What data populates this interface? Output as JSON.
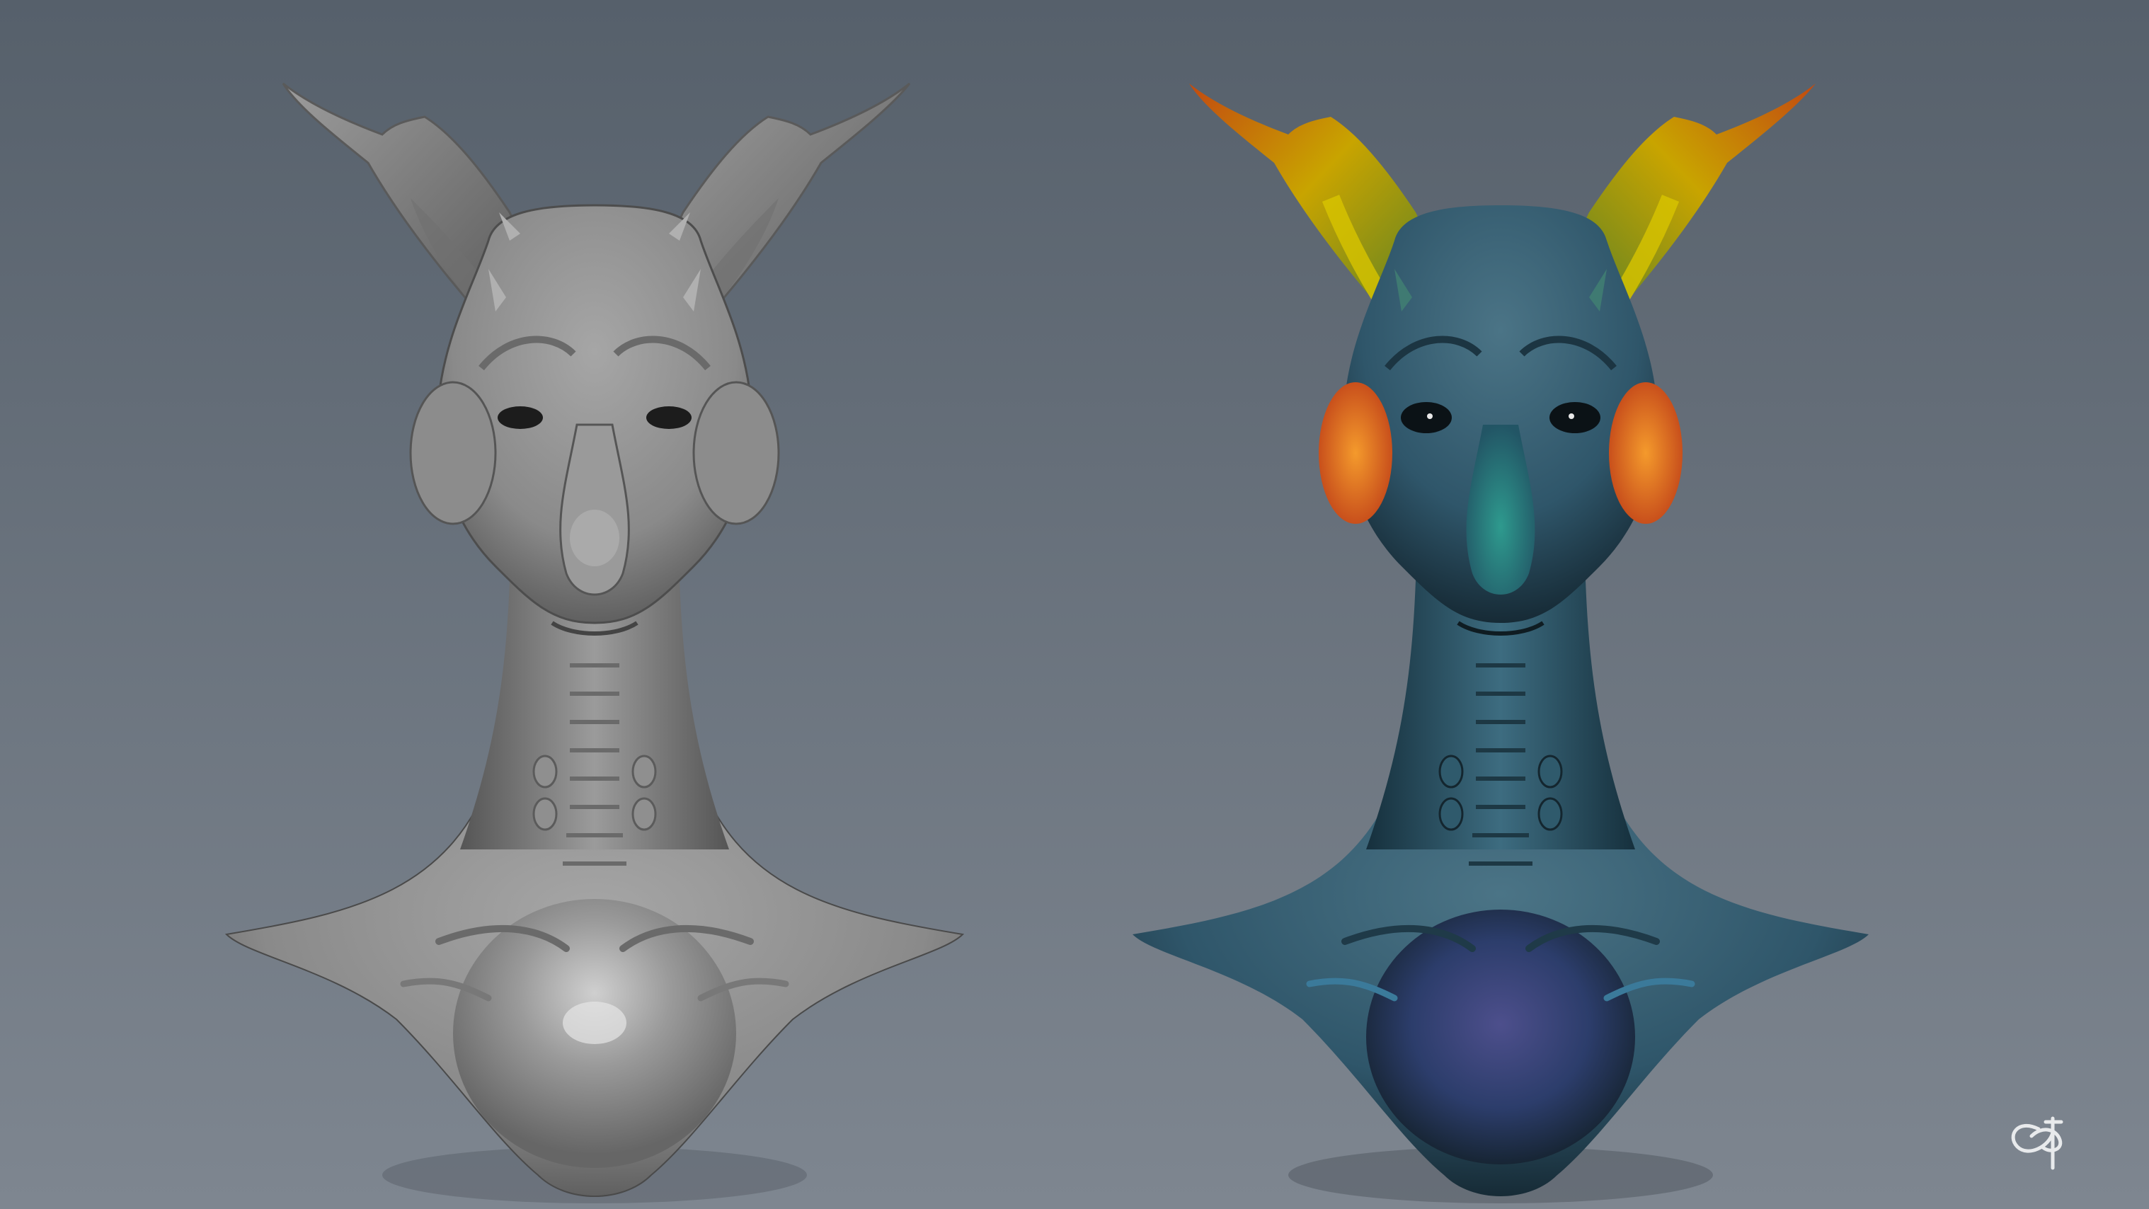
{
  "scene": {
    "background_top": "#56606b",
    "background_bottom": "#7d858f",
    "render_count": 2
  },
  "renders": [
    {
      "name": "clay-render",
      "style": "grey-clay",
      "base_color": "#8c8c8c"
    },
    {
      "name": "painted-render",
      "style": "color-painted",
      "base_color": "#3f6778",
      "accent_colors": [
        "#d0b800",
        "#e4691b",
        "#c8571c",
        "#2a8a8a"
      ]
    }
  ],
  "logo": {
    "icon": "signature-logo-icon",
    "color": "#e8eaec"
  }
}
